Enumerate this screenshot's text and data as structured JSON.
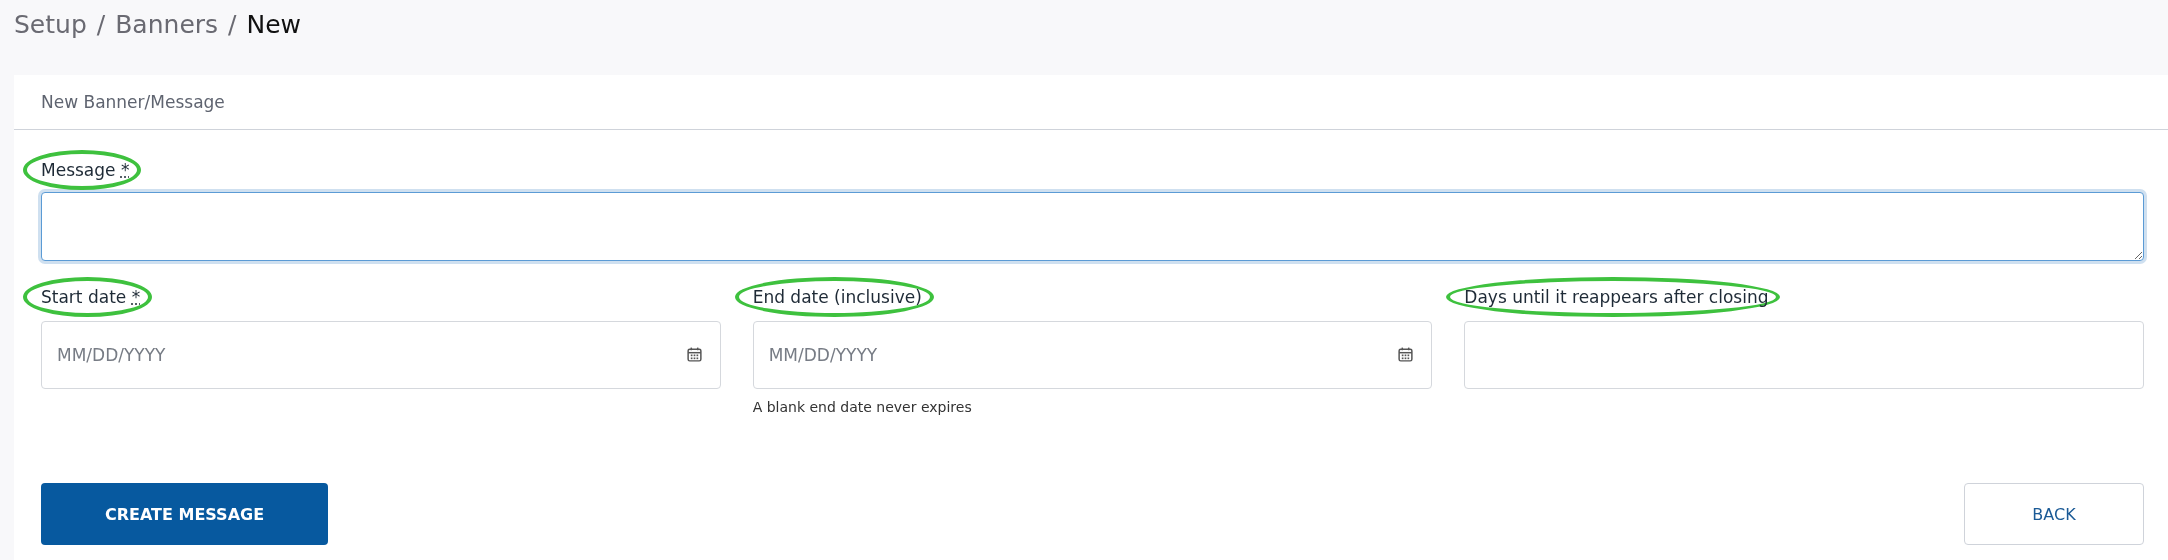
{
  "breadcrumb": [
    {
      "label": "Setup",
      "current": false
    },
    {
      "label": "Banners",
      "current": false
    },
    {
      "label": "New",
      "current": true
    }
  ],
  "breadcrumb_separator": "/",
  "card": {
    "title": "New Banner/Message"
  },
  "message_field": {
    "label": "Message",
    "required_mark": "*",
    "highlighted": true,
    "focused": true
  },
  "fields": [
    {
      "kind": "date",
      "label": "Start date",
      "required_mark": "*",
      "placeholder": "MM/DD/YYYY",
      "highlighted": true
    },
    {
      "kind": "date",
      "label": "End date (inclusive)",
      "placeholder": "MM/DD/YYYY",
      "help": "A blank end date never expires",
      "highlighted": true
    },
    {
      "kind": "text",
      "label": "Days until it reappears after closing",
      "highlighted": true
    }
  ],
  "buttons": [
    {
      "kind": "primary",
      "label": "CREATE MESSAGE"
    },
    {
      "kind": "secondary",
      "label": "BACK"
    }
  ]
}
